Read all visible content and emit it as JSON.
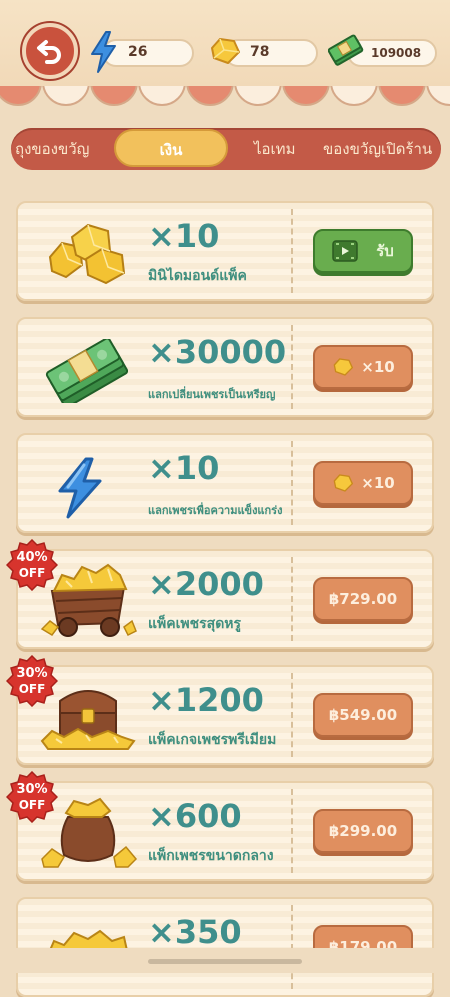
{
  "resources": {
    "energy": "26",
    "diamonds": "78",
    "cash": "109008"
  },
  "tabs": [
    {
      "label": "ถุงของขวัญ",
      "active": false
    },
    {
      "label": "เงิน",
      "active": true
    },
    {
      "label": "ไอเทม",
      "active": false
    },
    {
      "label": "ของขวัญเปิดร้าน",
      "active": false
    }
  ],
  "offers": [
    {
      "amount": "×10",
      "desc": "มินิไดมอนด์แพ็ค",
      "button": "รับ",
      "icon": "diamond-pile-icon"
    },
    {
      "amount": "×30000",
      "desc": "แลกเปลี่ยนเพชรเป็นเหรียญ",
      "button": "×10",
      "icon": "cash-stack-icon"
    },
    {
      "amount": "×10",
      "desc": "แลกเพชรเพื่อความแข็งแกร่ง",
      "button": "×10",
      "icon": "lightning-icon"
    },
    {
      "amount": "×2000",
      "desc": "แพ็คเพชรสุดหรู",
      "button": "฿729.00",
      "badge_pct": "40%",
      "badge_off": "OFF",
      "icon": "diamond-cart-icon"
    },
    {
      "amount": "×1200",
      "desc": "แพ็คเกจเพชรพรีเมียม",
      "button": "฿549.00",
      "badge_pct": "30%",
      "badge_off": "OFF",
      "icon": "treasure-chest-icon"
    },
    {
      "amount": "×600",
      "desc": "แพ็กเพชรขนาดกลาง",
      "button": "฿299.00",
      "badge_pct": "30%",
      "badge_off": "OFF",
      "icon": "diamond-sack-icon"
    },
    {
      "amount": "×350",
      "desc": "",
      "button": "฿179.00",
      "icon": "diamond-crate-icon"
    }
  ],
  "colors": {
    "accent_red": "#c35a47",
    "teal_text": "#3f8f8c",
    "orange_button": "#e08f5f",
    "green_button": "#69ad4e",
    "tab_active": "#f2c15c"
  }
}
